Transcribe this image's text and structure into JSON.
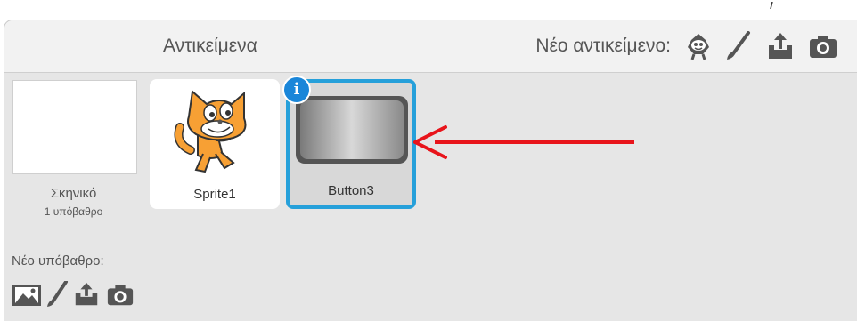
{
  "header": {
    "title": "Αντικείμενα",
    "new_sprite_label": "Νέο αντικείμενο:",
    "new_sprite_icons": [
      "sprite-library-icon",
      "paint-brush-icon",
      "upload-icon",
      "camera-icon"
    ]
  },
  "stage": {
    "name": "Σκηνικό",
    "backdrop_count": "1 υπόβαθρο",
    "new_backdrop_label": "Νέο υπόβαθρο:",
    "new_backdrop_icons": [
      "landscape-image-icon",
      "paint-brush-icon",
      "upload-icon",
      "camera-icon"
    ]
  },
  "sprites": [
    {
      "name": "Sprite1",
      "selected": false,
      "thumbnail": "cat-icon"
    },
    {
      "name": "Button3",
      "selected": true,
      "thumbnail": "button-shape-icon",
      "info_icon": "info-icon"
    }
  ],
  "annotation": {
    "arrow_color": "#e8141b",
    "points_to": "Button3"
  },
  "colors": {
    "selection": "#26a0da",
    "info_badge": "#1a86d9",
    "text": "#555555"
  }
}
